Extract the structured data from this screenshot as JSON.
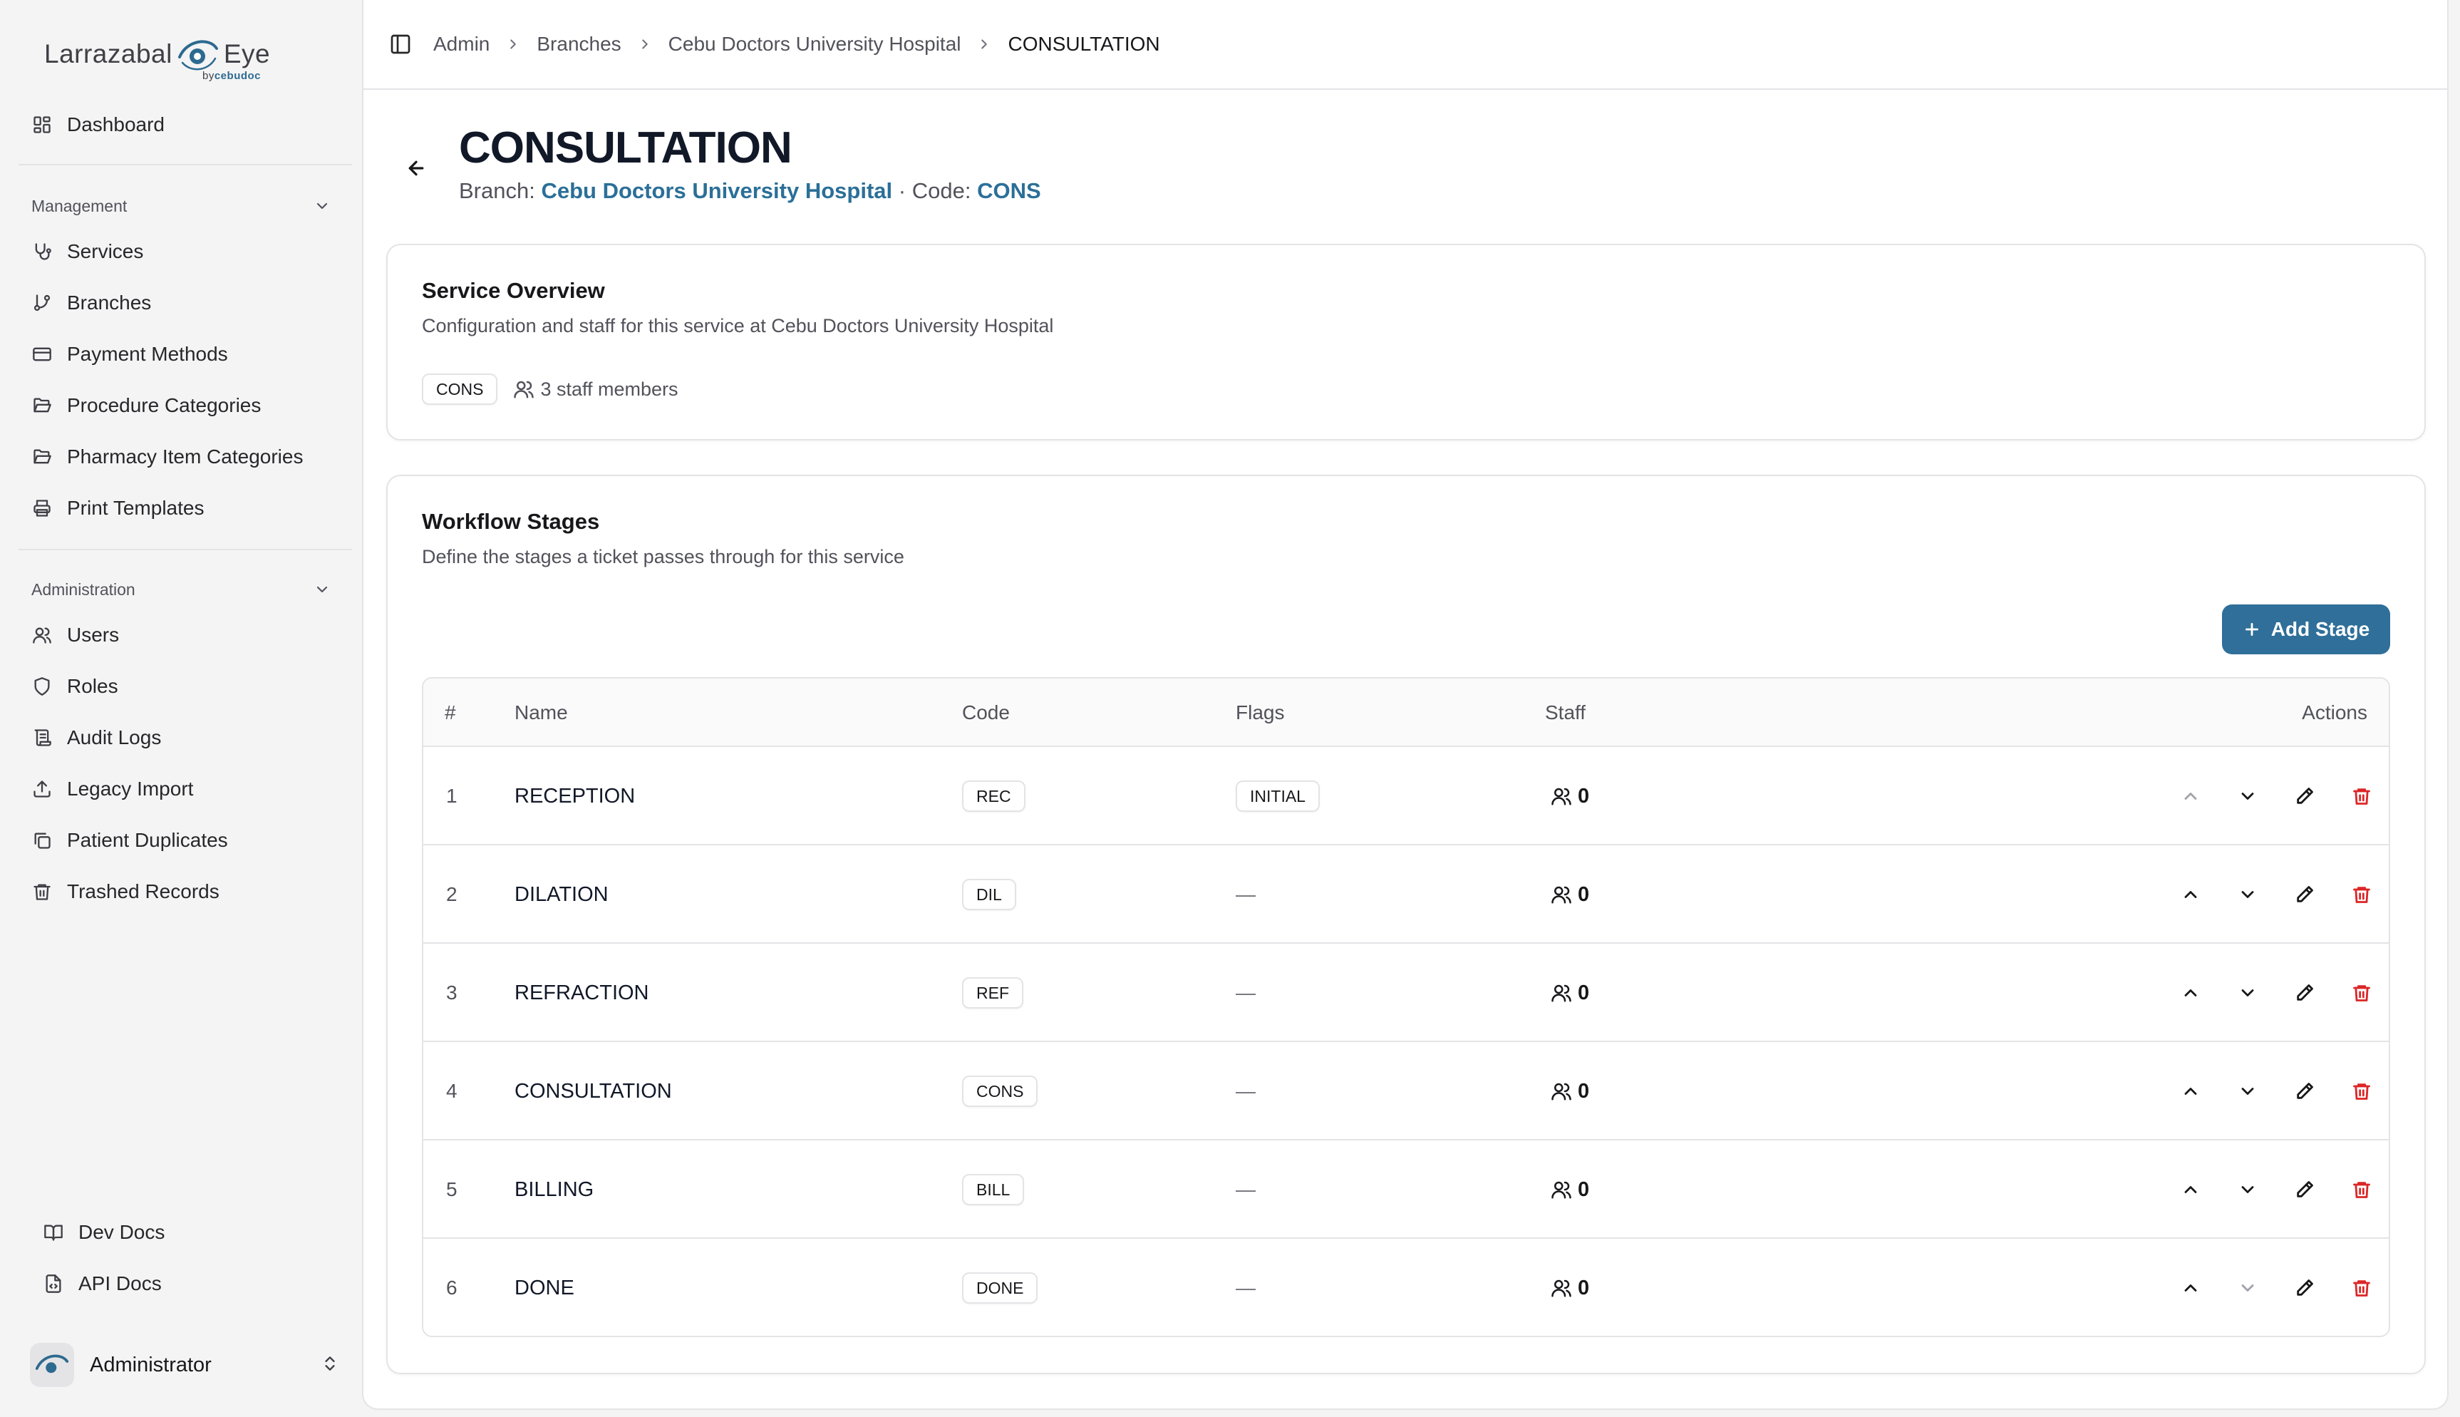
{
  "logo": {
    "brand_left": "Larrazabal",
    "brand_right": "Eye",
    "brand_sub_prefix": "by",
    "brand_sub": "cebudoc"
  },
  "sidebar": {
    "dashboard": "Dashboard",
    "management": {
      "heading": "Management",
      "items": [
        "Services",
        "Branches",
        "Payment Methods",
        "Procedure Categories",
        "Pharmacy Item Categories",
        "Print Templates"
      ]
    },
    "administration": {
      "heading": "Administration",
      "items": [
        "Users",
        "Roles",
        "Audit Logs",
        "Legacy Import",
        "Patient Duplicates",
        "Trashed Records"
      ]
    },
    "footer_links": [
      "Dev Docs",
      "API Docs"
    ],
    "user": {
      "name": "Administrator"
    }
  },
  "breadcrumb": [
    "Admin",
    "Branches",
    "Cebu Doctors University Hospital",
    "CONSULTATION"
  ],
  "header": {
    "title": "CONSULTATION",
    "branch_label": "Branch:",
    "branch_name": "Cebu Doctors University Hospital",
    "separator": "·",
    "code_label": "Code:",
    "code": "CONS"
  },
  "overview": {
    "title": "Service Overview",
    "description": "Configuration and staff for this service at Cebu Doctors University Hospital",
    "code_badge": "CONS",
    "staff_text": "3 staff members"
  },
  "workflow": {
    "title": "Workflow Stages",
    "description": "Define the stages a ticket passes through for this service",
    "add_button": "Add Stage",
    "columns": {
      "num": "#",
      "name": "Name",
      "code": "Code",
      "flags": "Flags",
      "staff": "Staff",
      "actions": "Actions"
    },
    "rows": [
      {
        "num": "1",
        "name": "RECEPTION",
        "code": "REC",
        "flag": "INITIAL",
        "staff": "0"
      },
      {
        "num": "2",
        "name": "DILATION",
        "code": "DIL",
        "flag": "—",
        "staff": "0"
      },
      {
        "num": "3",
        "name": "REFRACTION",
        "code": "REF",
        "flag": "—",
        "staff": "0"
      },
      {
        "num": "4",
        "name": "CONSULTATION",
        "code": "CONS",
        "flag": "—",
        "staff": "0"
      },
      {
        "num": "5",
        "name": "BILLING",
        "code": "BILL",
        "flag": "—",
        "staff": "0"
      },
      {
        "num": "6",
        "name": "DONE",
        "code": "DONE",
        "flag": "—",
        "staff": "0"
      }
    ]
  },
  "colors": {
    "accent": "#2f6f99",
    "link": "#2b6f98",
    "danger": "#dc2626"
  }
}
